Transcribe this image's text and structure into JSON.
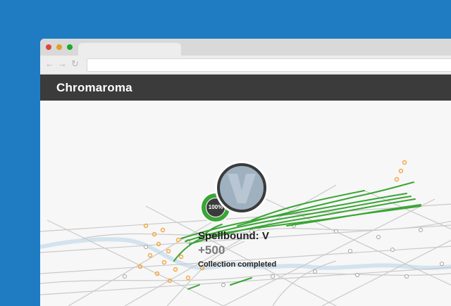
{
  "app": {
    "brand": "Chromaroma"
  },
  "nav": {
    "back_icon": "back-arrow-icon",
    "forward_icon": "forward-arrow-icon",
    "reload_icon": "reload-icon"
  },
  "map": {
    "route_color": "#3aa535",
    "station_color": "#f2a640"
  },
  "achievement": {
    "progress_label": "100%",
    "progress": 1.0,
    "badge_icon": "letter-v-badge-icon",
    "title": "Spellbound: V",
    "score": "+500",
    "status": "Collection completed"
  },
  "colors": {
    "background": "#1f7cc2",
    "appbar": "#3b3b3b",
    "accent": "#3aa535"
  }
}
